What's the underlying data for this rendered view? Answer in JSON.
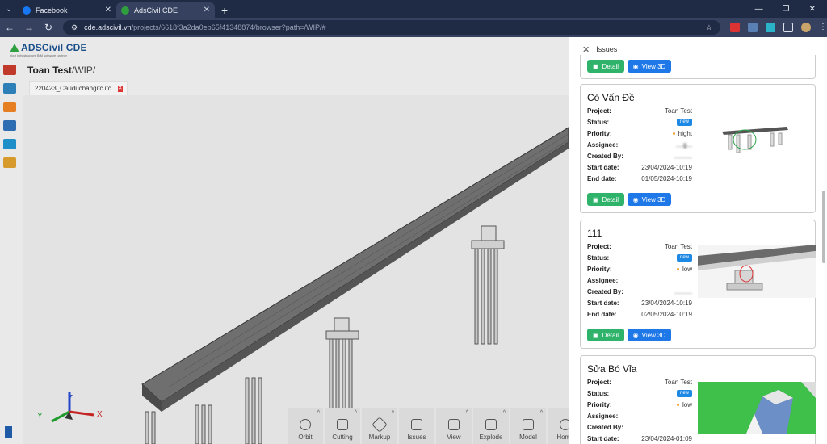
{
  "browser": {
    "tabs": [
      {
        "title": "Facebook",
        "fav_color": "#1877f2",
        "active": false
      },
      {
        "title": "AdsCivil CDE",
        "fav_color": "#2e9e3e",
        "active": true
      }
    ],
    "url_host": "cde.adscivil.vn",
    "url_path": "/projects/6618f3a2da0eb65f41348874/browser?path=/WIP/#"
  },
  "app": {
    "logo": "ADSCivil CDE",
    "logo_tagline": "Your Infrastructure BIM software partner",
    "breadcrumb_project": "Toan Test",
    "breadcrumb_path": "/WIP/",
    "file_tab": "220423_Cauduchangifc.ifc",
    "axis_labels": {
      "x": "X",
      "y": "Y",
      "z": "Z"
    },
    "toolbar": [
      "Orbit",
      "Cutting",
      "Markup",
      "Issues",
      "View",
      "Explode",
      "Model",
      "Home"
    ]
  },
  "panel": {
    "title": "Issues",
    "labels": {
      "project": "Project:",
      "status": "Status:",
      "priority": "Priority:",
      "assignee": "Assignee:",
      "created_by": "Created By:",
      "start_date": "Start date:",
      "end_date": "End date:"
    },
    "buttons": {
      "detail": "Detail",
      "view3d": "View 3D"
    },
    "issues": [
      {
        "title": "Có Vấn Đề",
        "project": "Toan Test",
        "status": "new",
        "priority": "hight",
        "priority_color": "#f0a030",
        "assignee": "....g...",
        "created_by": "..........",
        "start_date": "23/04/2024-10:19",
        "end_date": "01/05/2024-10:19"
      },
      {
        "title": "111",
        "project": "Toan Test",
        "status": "new",
        "priority": "low",
        "priority_color": "#f0a030",
        "assignee": "",
        "created_by": "..........",
        "start_date": "23/04/2024-10:19",
        "end_date": "02/05/2024-10:19"
      },
      {
        "title": "Sửa Bó Vỉa",
        "project": "Toan Test",
        "status": "new",
        "priority": "low",
        "priority_color": "#f0a030",
        "assignee": "",
        "created_by": "",
        "start_date": "23/04/2024-01:09",
        "end_date": ""
      }
    ]
  }
}
